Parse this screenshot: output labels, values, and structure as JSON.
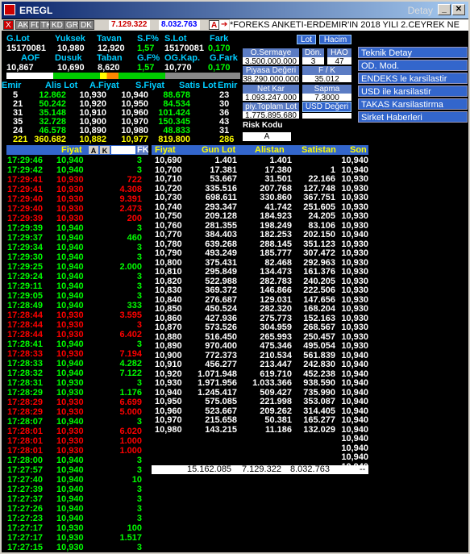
{
  "window": {
    "title": "EREGL",
    "detay": "Detay"
  },
  "toolbar": {
    "buttons": [
      "X",
      "AK",
      "FD",
      "TK",
      "KD",
      "GR",
      "DK"
    ],
    "price1": "7.129.322",
    "price2": "8.032.763",
    "alert_label": "A"
  },
  "ticker": "*FOREKS ANKETI-ERDEMIR'IN 2018 YILI 2.CEYREK NE",
  "summary": {
    "headers1": [
      "G.Lot",
      "Yuksek",
      "Tavan",
      "S.F%",
      "S.Lot",
      "Fark"
    ],
    "values1": [
      "15170081",
      "10,980",
      "12,920",
      "1,57",
      "15170081",
      "0,170"
    ],
    "headers2": [
      "AOF",
      "Dusuk",
      "Taban",
      "G.F%",
      "OG.Kap.",
      "G.Fark"
    ],
    "values2": [
      "10,867",
      "10,690",
      "8,620",
      "1,57",
      "10,770",
      "0,170"
    ]
  },
  "depth": {
    "headers": [
      "Emir",
      "Alis Lot",
      "A.Fiyat",
      "S.Fiyat",
      "Satis Lot",
      "Emir"
    ],
    "rows": [
      [
        "5",
        "12.862",
        "10,930",
        "10,940",
        "88.678",
        "23"
      ],
      [
        "21",
        "50.242",
        "10,920",
        "10,950",
        "84.534",
        "30"
      ],
      [
        "31",
        "35.148",
        "10,910",
        "10,960",
        "101.424",
        "36"
      ],
      [
        "35",
        "32.728",
        "10,900",
        "10,970",
        "150.345",
        "43"
      ],
      [
        "24",
        "46.578",
        "10,890",
        "10,980",
        "48.833",
        "31"
      ],
      [
        "221",
        "360.682",
        "10,882",
        "10,977",
        "819.800",
        "286"
      ]
    ]
  },
  "right_panel": {
    "btn_lot": "Lot",
    "btn_hacim": "Hacim",
    "o_sermaye_label": "O.Sermaye",
    "o_sermaye": "3.500.000.000",
    "don_label": "Dön.",
    "don": "3",
    "hao_label": "HAO",
    "hao": "47",
    "piyasa_label": "Piyasa Değeri",
    "piyasa": "38.290.000.000",
    "fk_label": "F / K",
    "fk": "35.012",
    "netkar_label": "Net Kar",
    "netkar": "1.093.247.000",
    "sapma_label": "Sapma",
    "sapma": "7,3000",
    "piy_label": "piy.Toplam Lot",
    "piy": "1.775.895.680",
    "usd_label": "USD Değeri",
    "risk_label": "Risk Kodu",
    "risk": "A"
  },
  "menu": [
    "Teknik Detay",
    "OD. Mod.",
    "ENDEKS le karsilastir",
    "USD ile karsilastir",
    "TAKAS Karsilastirma",
    "Sirket Haberleri"
  ],
  "trades": {
    "headers": [
      "",
      "Fiyat",
      "A",
      "K",
      "",
      "FK"
    ],
    "rows": [
      [
        "17:29:46",
        "10,940",
        "3",
        "g"
      ],
      [
        "17:29:42",
        "10,940",
        "3",
        "g"
      ],
      [
        "17:29:41",
        "10,930",
        "722",
        "r"
      ],
      [
        "17:29:41",
        "10,930",
        "4.308",
        "r"
      ],
      [
        "17:29:40",
        "10,930",
        "9.391",
        "r"
      ],
      [
        "17:29:40",
        "10,930",
        "2.473",
        "r"
      ],
      [
        "17:29:39",
        "10,930",
        "200",
        "r"
      ],
      [
        "17:29:39",
        "10,940",
        "3",
        "g"
      ],
      [
        "17:29:37",
        "10,940",
        "460",
        "g"
      ],
      [
        "17:29:34",
        "10,940",
        "3",
        "g"
      ],
      [
        "17:29:30",
        "10,940",
        "3",
        "g"
      ],
      [
        "17:29:25",
        "10,940",
        "2.000",
        "g"
      ],
      [
        "17:29:24",
        "10,940",
        "3",
        "g"
      ],
      [
        "17:29:11",
        "10,940",
        "3",
        "g"
      ],
      [
        "17:29:05",
        "10,940",
        "3",
        "g"
      ],
      [
        "17:28:49",
        "10,940",
        "333",
        "g"
      ],
      [
        "17:28:44",
        "10,930",
        "3.595",
        "r"
      ],
      [
        "17:28:44",
        "10,930",
        "3",
        "r"
      ],
      [
        "17:28:44",
        "10,930",
        "6.402",
        "r"
      ],
      [
        "17:28:41",
        "10,940",
        "3",
        "g"
      ],
      [
        "17:28:33",
        "10,930",
        "7.194",
        "r"
      ],
      [
        "17:28:33",
        "10,940",
        "4.282",
        "g"
      ],
      [
        "17:28:32",
        "10,940",
        "7.122",
        "g"
      ],
      [
        "17:28:31",
        "10,930",
        "3",
        "g"
      ],
      [
        "17:28:29",
        "10,930",
        "1.176",
        "g"
      ],
      [
        "17:28:29",
        "10,930",
        "6.699",
        "r"
      ],
      [
        "17:28:29",
        "10,930",
        "5.000",
        "r"
      ],
      [
        "17:28:07",
        "10,940",
        "3",
        "g"
      ],
      [
        "17:28:01",
        "10,930",
        "6.020",
        "r"
      ],
      [
        "17:28:01",
        "10,930",
        "1.000",
        "r"
      ],
      [
        "17:28:01",
        "10,930",
        "1.000",
        "r"
      ],
      [
        "17:28:00",
        "10,940",
        "3",
        "g"
      ],
      [
        "17:27:57",
        "10,940",
        "3",
        "g"
      ],
      [
        "17:27:40",
        "10,940",
        "10",
        "g"
      ],
      [
        "17:27:39",
        "10,940",
        "3",
        "g"
      ],
      [
        "17:27:37",
        "10,940",
        "3",
        "g"
      ],
      [
        "17:27:26",
        "10,940",
        "3",
        "g"
      ],
      [
        "17:27:23",
        "10,940",
        "3",
        "g"
      ],
      [
        "17:27:17",
        "10,930",
        "100",
        "g"
      ],
      [
        "17:27:17",
        "10,930",
        "1.517",
        "g"
      ],
      [
        "17:27:15",
        "10,930",
        "3",
        "g"
      ]
    ]
  },
  "distribution": {
    "headers": [
      "Fiyat",
      "Gun Lot",
      "Alistan",
      "Satistan",
      "Son"
    ],
    "rows": [
      [
        "10,690",
        "1.401",
        "1.401",
        "",
        "10,940"
      ],
      [
        "10,700",
        "17.381",
        "17.380",
        "1",
        "10,940"
      ],
      [
        "10,710",
        "53.667",
        "31.501",
        "22.166",
        "10,930"
      ],
      [
        "10,720",
        "335.516",
        "207.768",
        "127.748",
        "10,930"
      ],
      [
        "10,730",
        "698.611",
        "330.860",
        "367.751",
        "10,930"
      ],
      [
        "10,740",
        "293.347",
        "41.742",
        "251.605",
        "10,930"
      ],
      [
        "10,750",
        "209.128",
        "184.923",
        "24.205",
        "10,930"
      ],
      [
        "10,760",
        "281.355",
        "198.249",
        "83.106",
        "10,930"
      ],
      [
        "10,770",
        "384.403",
        "182.253",
        "202.150",
        "10,940"
      ],
      [
        "10,780",
        "639.268",
        "288.145",
        "351.123",
        "10,930"
      ],
      [
        "10,790",
        "493.249",
        "185.777",
        "307.472",
        "10,930"
      ],
      [
        "10,800",
        "375.431",
        "82.468",
        "292.963",
        "10,930"
      ],
      [
        "10,810",
        "295.849",
        "134.473",
        "161.376",
        "10,930"
      ],
      [
        "10,820",
        "522.988",
        "282.783",
        "240.205",
        "10,930"
      ],
      [
        "10,830",
        "369.372",
        "146.866",
        "222.506",
        "10,930"
      ],
      [
        "10,840",
        "276.687",
        "129.031",
        "147.656",
        "10,930"
      ],
      [
        "10,850",
        "450.524",
        "282.320",
        "168.204",
        "10,930"
      ],
      [
        "10,860",
        "427.936",
        "275.773",
        "152.163",
        "10,930"
      ],
      [
        "10,870",
        "573.526",
        "304.959",
        "268.567",
        "10,930"
      ],
      [
        "10,880",
        "516.450",
        "265.993",
        "250.457",
        "10,930"
      ],
      [
        "10,890",
        "970.400",
        "475.346",
        "495.054",
        "10,930"
      ],
      [
        "10,900",
        "772.373",
        "210.534",
        "561.839",
        "10,940"
      ],
      [
        "10,910",
        "456.277",
        "213.447",
        "242.830",
        "10,940"
      ],
      [
        "10,920",
        "1.071.948",
        "619.710",
        "452.238",
        "10,940"
      ],
      [
        "10,930",
        "1.971.956",
        "1.033.366",
        "938.590",
        "10,940"
      ],
      [
        "10,940",
        "1.245.417",
        "509.427",
        "735.990",
        "10,940"
      ],
      [
        "10,950",
        "575.085",
        "221.998",
        "353.087",
        "10,940"
      ],
      [
        "10,960",
        "523.667",
        "209.262",
        "314.405",
        "10,940"
      ],
      [
        "10,970",
        "215.658",
        "50.381",
        "165.277",
        "10,940"
      ],
      [
        "10,980",
        "143.215",
        "11.186",
        "132.029",
        "10,940"
      ],
      [
        "",
        "",
        "",
        "",
        "10,940"
      ],
      [
        "",
        "",
        "",
        "",
        "10,940"
      ],
      [
        "",
        "",
        "",
        "",
        "10,940"
      ],
      [
        "",
        "",
        "",
        "",
        "10,940"
      ]
    ],
    "totals": [
      "15.162.085",
      "7.129.322",
      "8.032.763",
      "--"
    ]
  },
  "colors": {
    "title_bg": "#0a246a",
    "header_blue": "#3366cc",
    "green": "#00ff00",
    "red": "#ff0000",
    "yellow": "#ffff00"
  }
}
